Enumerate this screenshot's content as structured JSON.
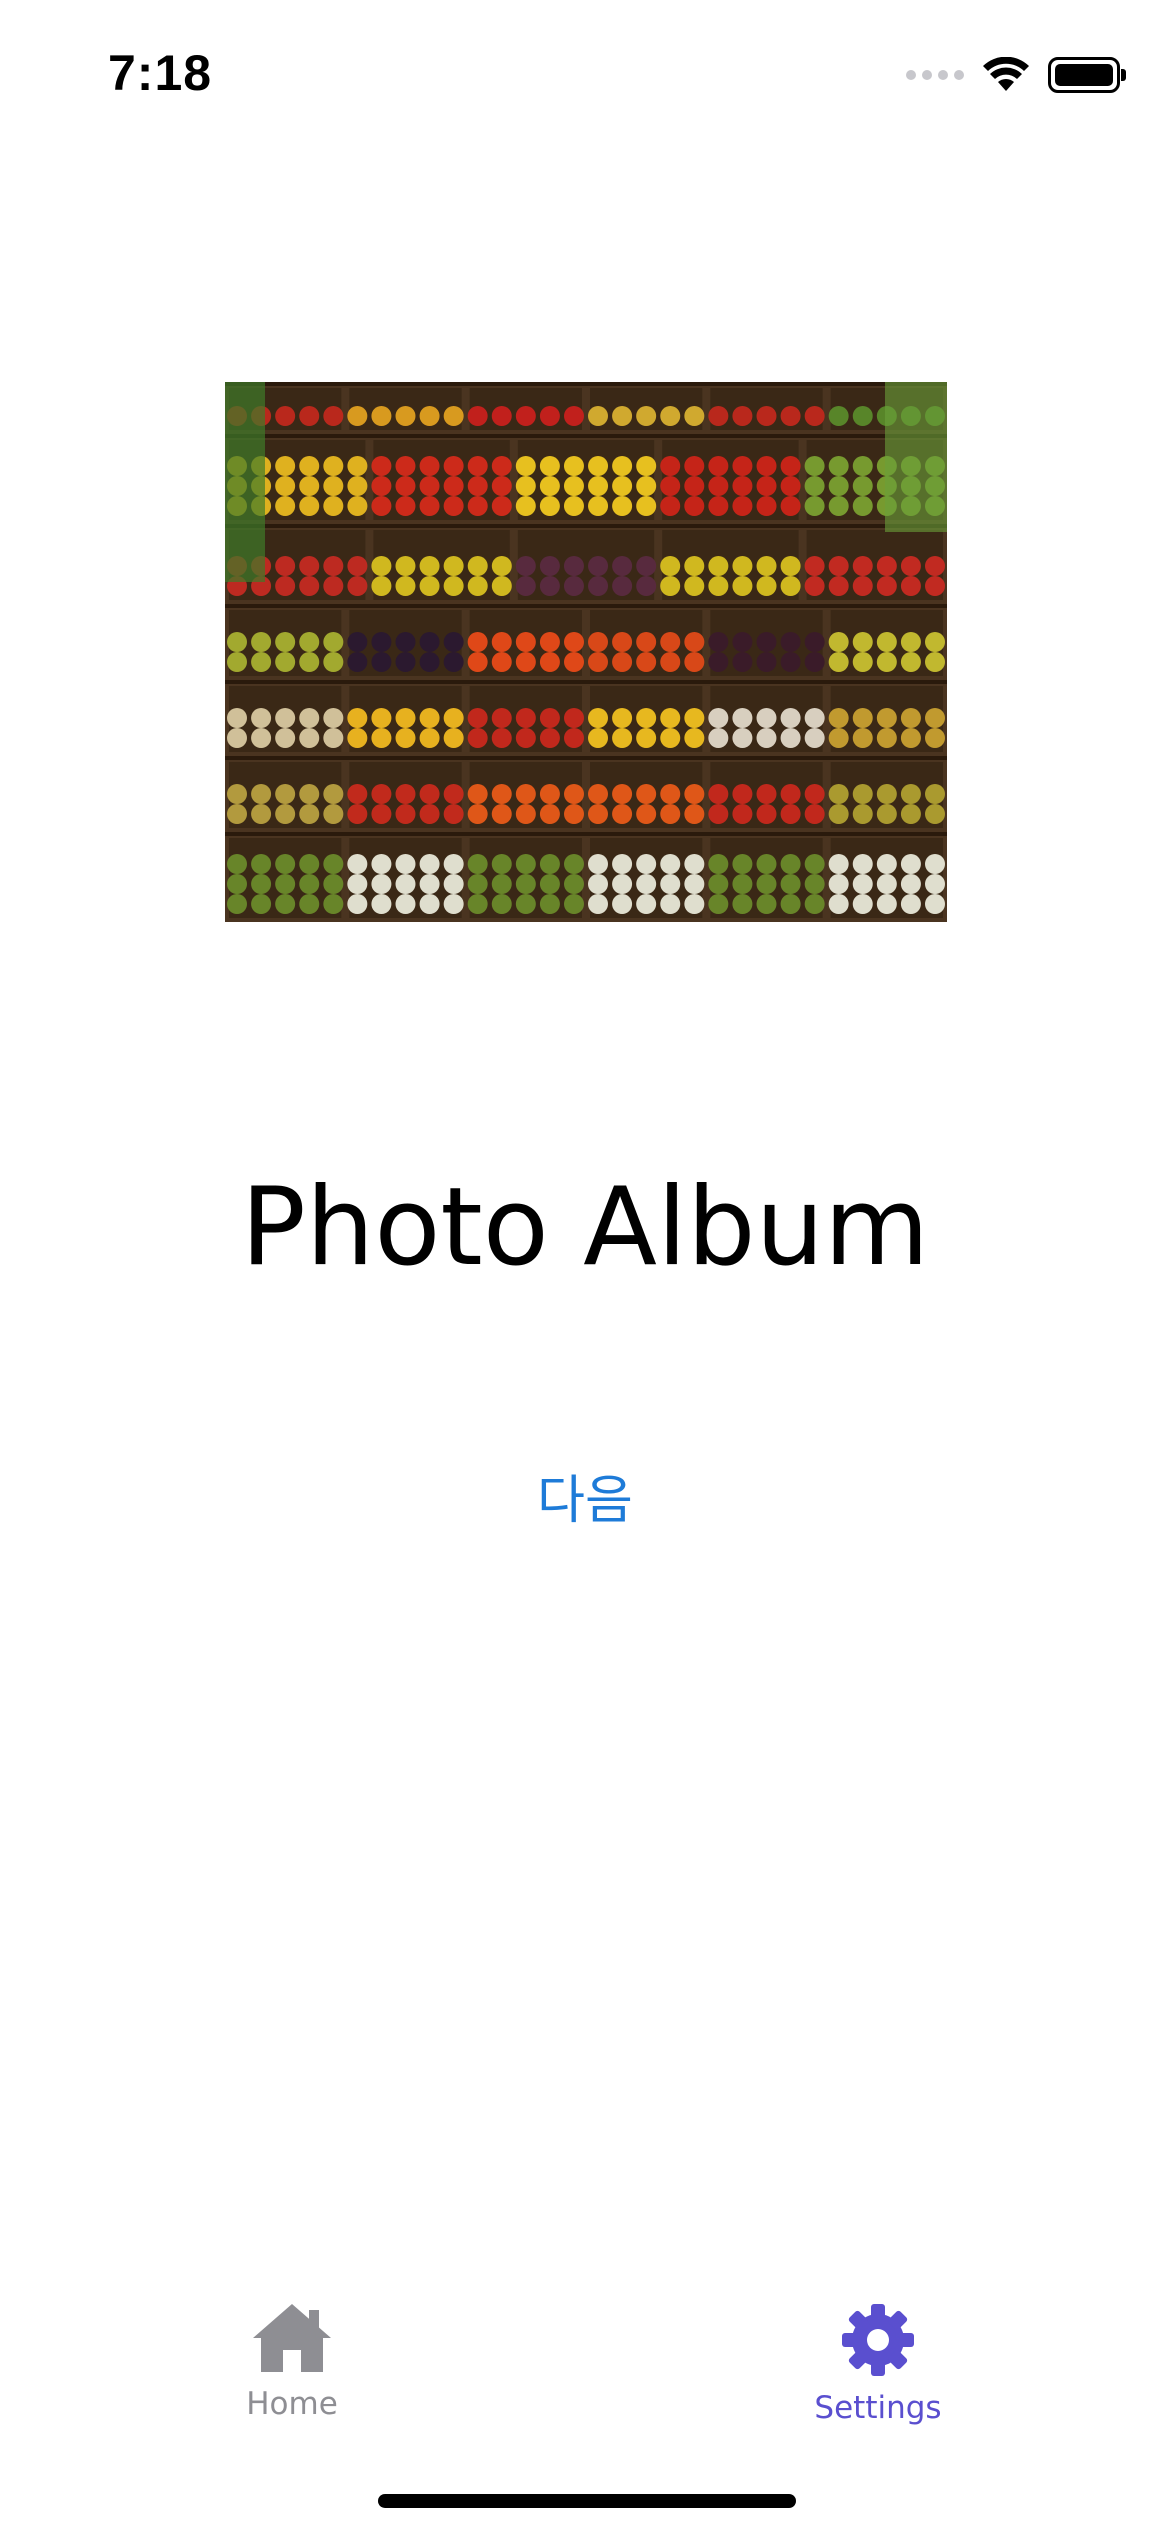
{
  "status_bar": {
    "time": "7:18",
    "icons": [
      "cellular-signal-icon",
      "wifi-icon",
      "battery-icon"
    ]
  },
  "main": {
    "image": {
      "semantic": "produce-market-shelves-photo",
      "alt": "Shelves of wooden crates filled with fruits and vegetables"
    },
    "title": "Photo Album",
    "next_button_label": "다음"
  },
  "tab_bar": {
    "tabs": [
      {
        "label": "Home",
        "icon": "house-icon",
        "selected": false,
        "color": "#8e8e93"
      },
      {
        "label": "Settings",
        "icon": "gear-icon",
        "selected": true,
        "color": "#5a4fcf"
      }
    ]
  },
  "colors": {
    "accent_link": "#1e7bd8",
    "tab_selected": "#5a4fcf",
    "tab_unselected": "#8e8e93"
  }
}
